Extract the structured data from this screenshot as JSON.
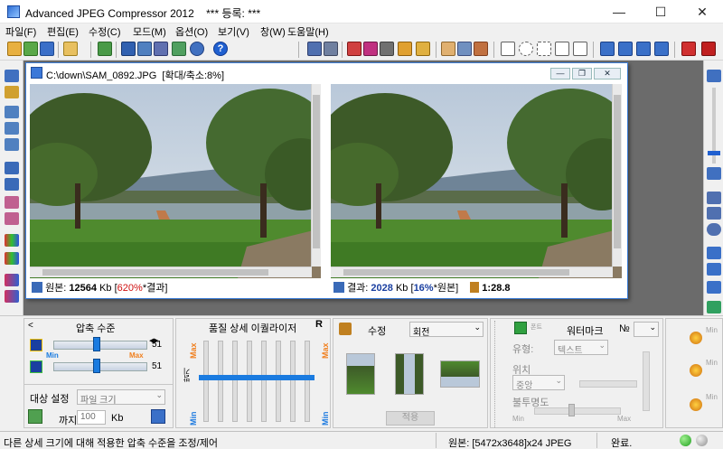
{
  "window": {
    "title": "Advanced JPEG Compressor 2012",
    "registration": "*** 등록: ***"
  },
  "menu": [
    {
      "label": "파일(F)"
    },
    {
      "label": "편집(E)"
    },
    {
      "label": "수정(C)"
    },
    {
      "label": "모드(M)"
    },
    {
      "label": "옵션(O)"
    },
    {
      "label": "보기(V)"
    },
    {
      "label": "창(W)"
    },
    {
      "label": "도움말(H)"
    }
  ],
  "child": {
    "title": "C:\\down\\SAM_0892.JPG  [확대/축소:8%]"
  },
  "original": {
    "label": "원본:",
    "size": "12564",
    "unit": "Kb",
    "ratio": "620%",
    "ratio_suffix": "*결과]",
    "ratio_prefix": "["
  },
  "result": {
    "label": "결과:",
    "size": "2028",
    "unit": "Kb",
    "ratio": "16%",
    "ratio_suffix": "*원본]",
    "ratio_prefix": "[",
    "compression": "1:28.8"
  },
  "compression": {
    "title": "압축 수준",
    "value1": "51",
    "value2": "51",
    "min": "Min",
    "max": "Max",
    "slider1": 0.5,
    "slider2": 0.5,
    "target_label": "대상 설정",
    "target_value": "파일 크기",
    "until_label": "까지",
    "until_value": "100",
    "until_unit": "Kb"
  },
  "equalizer": {
    "title": "품질 상세 이퀄라이저",
    "r_label": "R",
    "max": "Max",
    "min": "Min",
    "side_label": "밝기",
    "levels": [
      0.55,
      0.55,
      0.55,
      0.55,
      0.55,
      0.55,
      0.55,
      0.55
    ]
  },
  "edit": {
    "label": "수정",
    "value": "회전",
    "apply": "적용"
  },
  "watermark": {
    "title": "워터마크",
    "number_label": "№",
    "type_label": "유형:",
    "type_value": "텍스트",
    "position_label": "위치",
    "position_value": "중앙",
    "opacity_label": "불투명도",
    "min": "Min",
    "max": "Max",
    "add_label": "폰트"
  },
  "far_right": {
    "min": "Min"
  },
  "status": {
    "hint": "다른 상세 크기에 대해 적용한 압축 수준을 조정/제어",
    "source": "원본: [5472x3648]x24 JPEG",
    "done": "완료."
  },
  "colors": {
    "accent": "#1a7be0",
    "orange": "#f08020",
    "red": "#d01010",
    "navy": "#1a3fa0"
  }
}
